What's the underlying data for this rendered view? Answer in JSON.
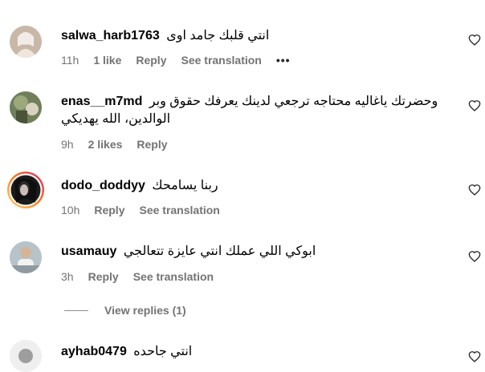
{
  "comments": [
    {
      "username": "salwa_harb1763",
      "text": "انتي قلبك جامد اوى",
      "time": "11h",
      "likes": "1 like",
      "reply": "Reply",
      "see_translation": "See translation",
      "more": "•••"
    },
    {
      "username": "enas__m7md",
      "text": "وحضرتك ياغاليه محتاجه ترجعي لدينك يعرفك حقوق وبر الوالدين، الله يهديكي",
      "time": "9h",
      "likes": "2 likes",
      "reply": "Reply"
    },
    {
      "username": "dodo_doddyy",
      "text": "ربنا يسامحك",
      "time": "10h",
      "reply": "Reply",
      "see_translation": "See translation"
    },
    {
      "username": "usamauy",
      "text": "ابوكي اللي عملك انتي عايزة تتعالجي",
      "time": "3h",
      "reply": "Reply",
      "see_translation": "See translation"
    },
    {
      "username": "ayhab0479",
      "text": "انتي جاحده"
    }
  ],
  "view_replies": "View replies (1)",
  "icons": {
    "like": "heart-icon",
    "more": "more-options-icon"
  },
  "colors": {
    "meta": "#737373",
    "story_ring_start": "#feda75",
    "story_ring_end": "#d62976"
  }
}
